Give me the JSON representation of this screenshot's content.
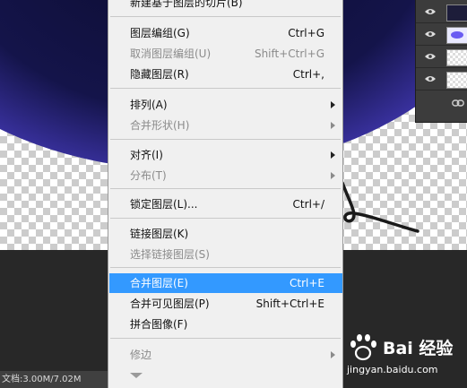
{
  "statusbar": {
    "doc_size": "文档:3.00M/7.02M"
  },
  "context_menu": {
    "items": [
      {
        "label": "新建基于图层的切片(B)",
        "shortcut": "",
        "disabled": false,
        "submenu": false
      },
      {
        "label": "图层编组(G)",
        "shortcut": "Ctrl+G",
        "disabled": false,
        "submenu": false
      },
      {
        "label": "取消图层编组(U)",
        "shortcut": "Shift+Ctrl+G",
        "disabled": true,
        "submenu": false
      },
      {
        "label": "隐藏图层(R)",
        "shortcut": "Ctrl+,",
        "disabled": false,
        "submenu": false
      },
      {
        "label": "排列(A)",
        "shortcut": "",
        "disabled": false,
        "submenu": true
      },
      {
        "label": "合并形状(H)",
        "shortcut": "",
        "disabled": true,
        "submenu": true
      },
      {
        "label": "对齐(I)",
        "shortcut": "",
        "disabled": false,
        "submenu": true
      },
      {
        "label": "分布(T)",
        "shortcut": "",
        "disabled": true,
        "submenu": true
      },
      {
        "label": "锁定图层(L)...",
        "shortcut": "Ctrl+/",
        "disabled": false,
        "submenu": false
      },
      {
        "label": "链接图层(K)",
        "shortcut": "",
        "disabled": false,
        "submenu": false
      },
      {
        "label": "选择链接图层(S)",
        "shortcut": "",
        "disabled": true,
        "submenu": false
      },
      {
        "label": "合并图层(E)",
        "shortcut": "Ctrl+E",
        "disabled": false,
        "submenu": false,
        "highlighted": true
      },
      {
        "label": "合并可见图层(P)",
        "shortcut": "Shift+Ctrl+E",
        "disabled": false,
        "submenu": false
      },
      {
        "label": "拼合图像(F)",
        "shortcut": "",
        "disabled": false,
        "submenu": false
      },
      {
        "label": "修边",
        "shortcut": "",
        "disabled": true,
        "submenu": true
      }
    ]
  },
  "watermark": {
    "brand": "Bai 经验",
    "url": "jingyan.baidu.com"
  },
  "colors": {
    "highlight": "#3399ff",
    "menu_bg": "#f0f0f0",
    "disabled_text": "#8b8b8b",
    "shape": "#6d5cf4"
  }
}
